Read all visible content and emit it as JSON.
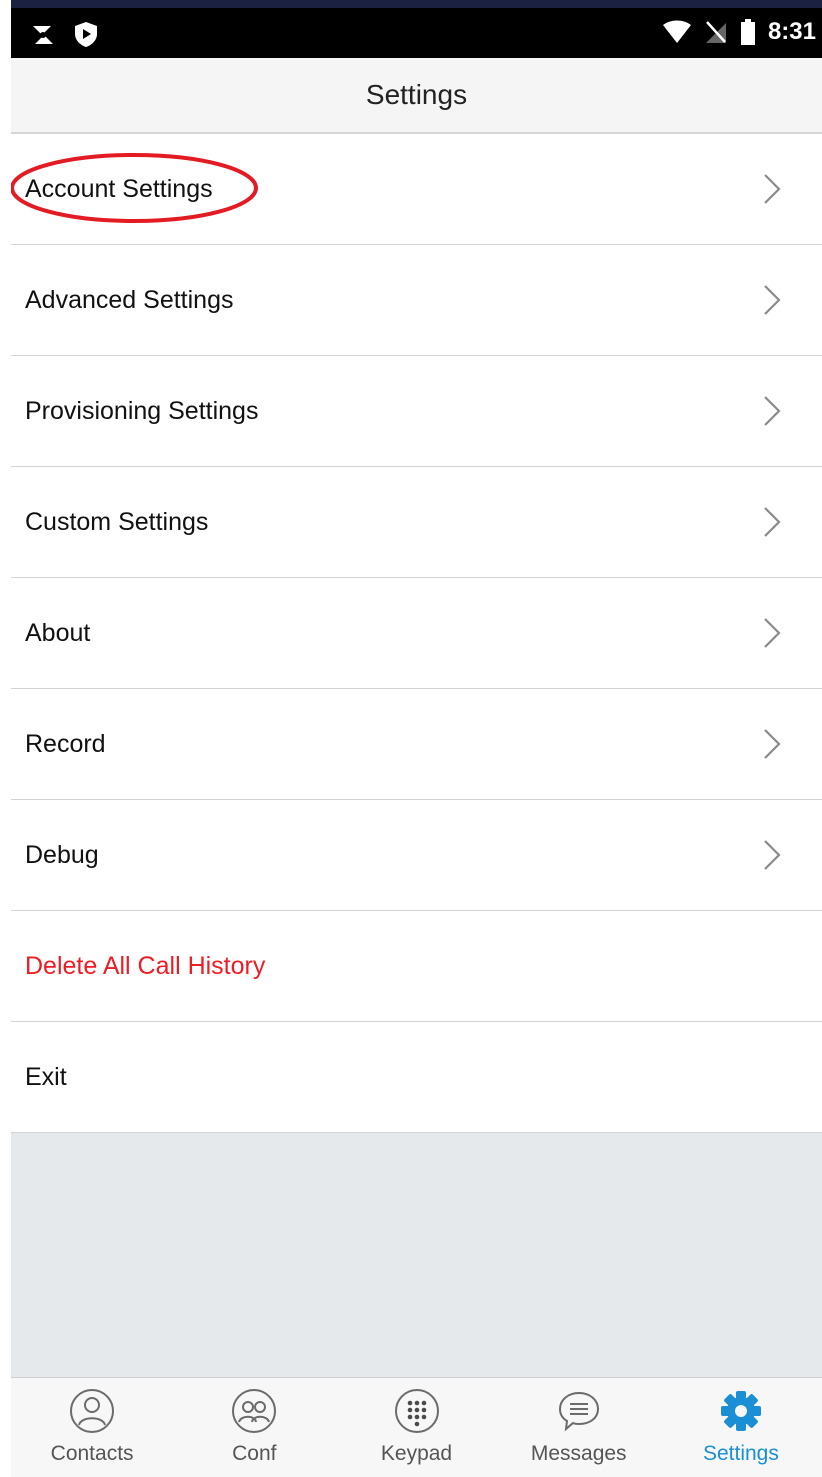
{
  "status_bar": {
    "time": "8:31",
    "left_icons": [
      "grandstream-icon",
      "shield-icon"
    ],
    "right_icons": [
      "wifi-icon",
      "no-sim-icon",
      "battery-icon"
    ]
  },
  "app_bar": {
    "title": "Settings"
  },
  "settings": {
    "items": [
      {
        "label": "Account Settings",
        "has_chevron": true,
        "highlighted": true
      },
      {
        "label": "Advanced Settings",
        "has_chevron": true
      },
      {
        "label": "Provisioning Settings",
        "has_chevron": true
      },
      {
        "label": "Custom Settings",
        "has_chevron": true
      },
      {
        "label": "About",
        "has_chevron": true
      },
      {
        "label": "Record",
        "has_chevron": true
      },
      {
        "label": "Debug",
        "has_chevron": true
      },
      {
        "label": "Delete All Call History",
        "has_chevron": false,
        "danger": true
      },
      {
        "label": "Exit",
        "has_chevron": false
      }
    ]
  },
  "bottom_nav": {
    "items": [
      {
        "label": "Contacts",
        "icon": "contact-icon"
      },
      {
        "label": "Conf",
        "icon": "conference-icon"
      },
      {
        "label": "Keypad",
        "icon": "keypad-icon"
      },
      {
        "label": "Messages",
        "icon": "messages-icon"
      },
      {
        "label": "Settings",
        "icon": "gear-icon",
        "active": true
      }
    ]
  },
  "colors": {
    "accent": "#1a8fd6",
    "danger": "#ee1c24",
    "highlight_ring": "#e31b23",
    "empty_area": "#e6e9ec"
  }
}
